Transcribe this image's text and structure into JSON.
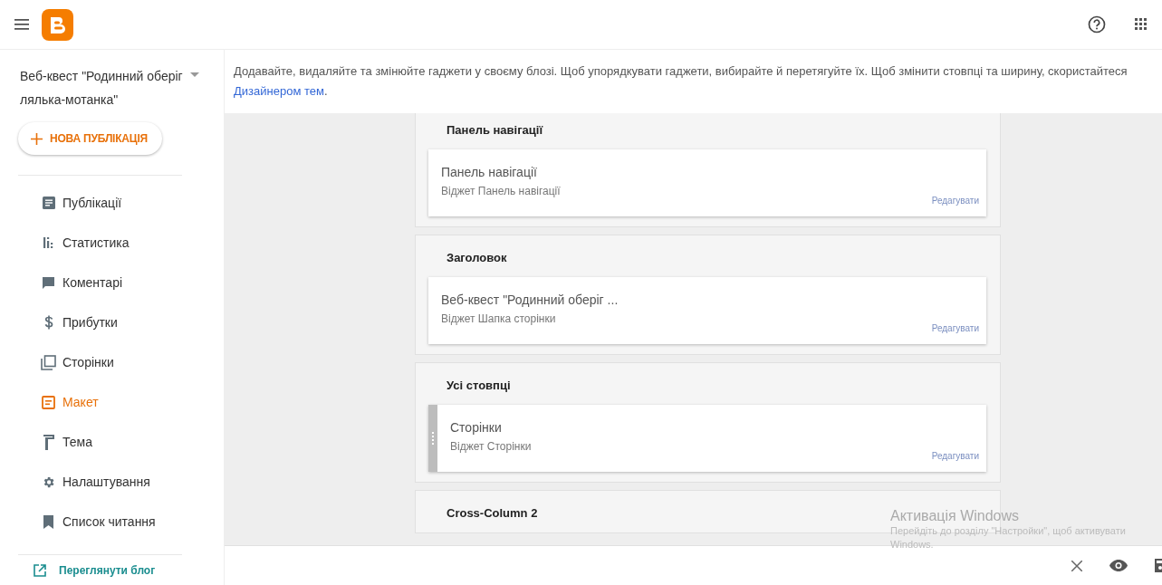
{
  "blog": {
    "title": "Веб-квест \"Родинний оберіг лялька-мотанка\""
  },
  "new_post_button": {
    "label": "НОВА ПУБЛІКАЦІЯ"
  },
  "nav": [
    {
      "label": "Публікації",
      "kind": "posts",
      "selected": false
    },
    {
      "label": "Статистика",
      "kind": "stats",
      "selected": false
    },
    {
      "label": "Коментарі",
      "kind": "comments",
      "selected": false
    },
    {
      "label": "Прибутки",
      "kind": "earnings",
      "selected": false
    },
    {
      "label": "Сторінки",
      "kind": "pages",
      "selected": false
    },
    {
      "label": "Макет",
      "kind": "layout",
      "selected": true
    },
    {
      "label": "Тема",
      "kind": "theme",
      "selected": false
    },
    {
      "label": "Налаштування",
      "kind": "settings",
      "selected": false
    },
    {
      "label": "Список читання",
      "kind": "reading",
      "selected": false
    }
  ],
  "view_blog_link": "Переглянути блог",
  "description": {
    "text": "Додавайте, видаляйте та змінюйте гаджети у своєму блозі. Щоб упорядкувати гаджети, вибирайте й перетягуйте їх. Щоб змінити стовпці та ширину, скористайтеся ",
    "link": "Дизайнером тем",
    "after": "."
  },
  "sections": [
    {
      "title": "Панель навігації",
      "widgets": [
        {
          "title": "Панель навігації",
          "subtitle": "Віджет Панель навігації",
          "edit": "Редагувати",
          "drag_handle": false
        }
      ]
    },
    {
      "title": "Заголовок",
      "widgets": [
        {
          "title": "Веб-квест \"Родинний оберіг ...",
          "subtitle": "Віджет Шапка сторінки",
          "edit": "Редагувати",
          "drag_handle": false
        }
      ]
    },
    {
      "title": "Усі стовпці",
      "widgets": [
        {
          "title": "Сторінки",
          "subtitle": "Віджет Сторінки",
          "edit": "Редагувати",
          "drag_handle": true
        }
      ]
    },
    {
      "title": "Cross-Column 2"
    }
  ],
  "windows_notice": {
    "title": "Активація Windows",
    "text": "Перейдіть до розділу \"Настройки\", щоб активувати Windows."
  }
}
